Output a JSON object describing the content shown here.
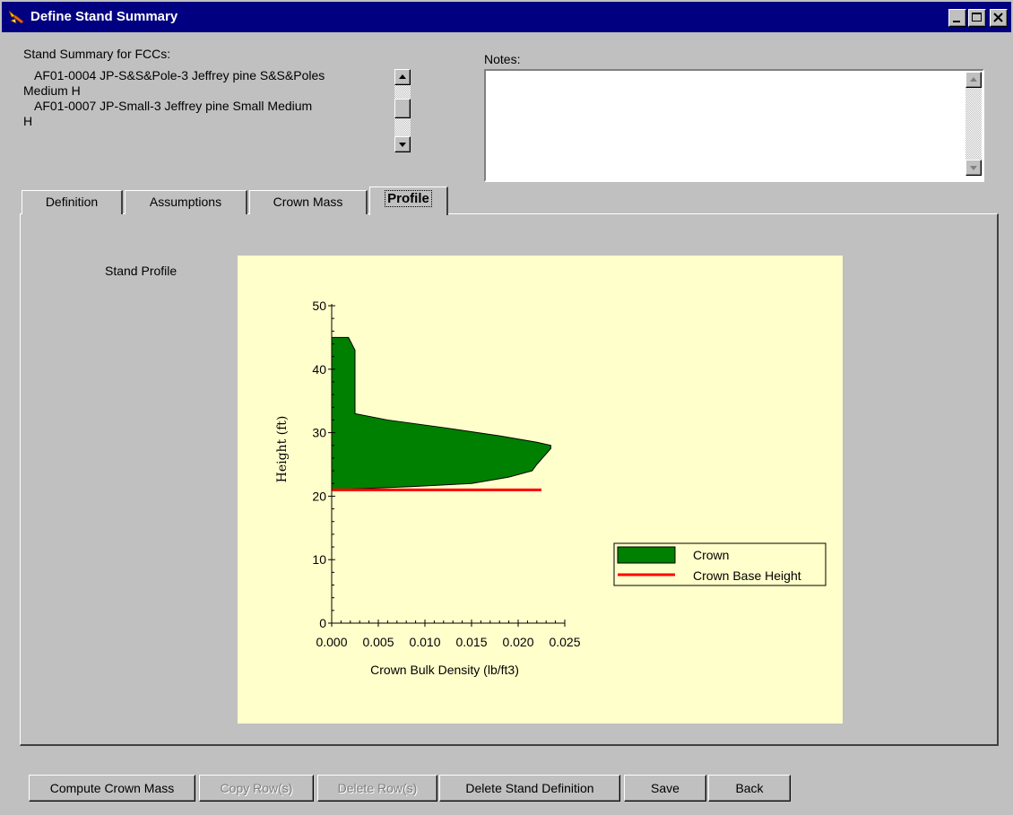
{
  "window": {
    "title": "Define Stand Summary"
  },
  "summary": {
    "label": "Stand Summary for FCCs:",
    "lines": [
      "AF01-0004  JP-S&S&Pole-3  Jeffrey pine  S&S&Poles",
      "Medium  H",
      "AF01-0007  JP-Small-3  Jeffrey pine  Small  Medium",
      "H"
    ]
  },
  "notes": {
    "label": "Notes:",
    "value": ""
  },
  "tabs": [
    {
      "label": "Definition"
    },
    {
      "label": "Assumptions"
    },
    {
      "label": "Crown Mass"
    },
    {
      "label": "Profile",
      "active": true
    }
  ],
  "profile": {
    "label": "Stand Profile"
  },
  "chart_data": {
    "type": "area",
    "xlabel": "Crown Bulk Density (lb/ft3)",
    "ylabel": "Height (ft)",
    "xlim": [
      0,
      0.025
    ],
    "ylim": [
      0,
      50
    ],
    "x_ticks": [
      "0.000",
      "0.005",
      "0.010",
      "0.015",
      "0.020",
      "0.025"
    ],
    "y_ticks": [
      "0",
      "10",
      "20",
      "30",
      "40",
      "50"
    ],
    "series": [
      {
        "name": "Crown",
        "color": "#008000",
        "points": [
          [
            0.0,
            21
          ],
          [
            0.0085,
            21.5
          ],
          [
            0.015,
            22
          ],
          [
            0.019,
            23
          ],
          [
            0.0215,
            24
          ],
          [
            0.022,
            25
          ],
          [
            0.0235,
            27.5
          ],
          [
            0.0235,
            28
          ],
          [
            0.022,
            28.5
          ],
          [
            0.018,
            29.5
          ],
          [
            0.012,
            30.8
          ],
          [
            0.006,
            32
          ],
          [
            0.0025,
            33
          ],
          [
            0.0025,
            43
          ],
          [
            0.0018,
            45
          ],
          [
            0.0,
            45
          ]
        ]
      },
      {
        "name": "Crown Base Height",
        "color": "#ff0000",
        "points": [
          [
            0.0,
            21
          ],
          [
            0.0225,
            21
          ]
        ]
      }
    ],
    "legend_position": "right"
  },
  "buttons": {
    "compute": "Compute Crown Mass",
    "copy": "Copy Row(s)",
    "delete_rows": "Delete Row(s)",
    "delete_stand": "Delete Stand Definition",
    "save": "Save",
    "back": "Back"
  }
}
